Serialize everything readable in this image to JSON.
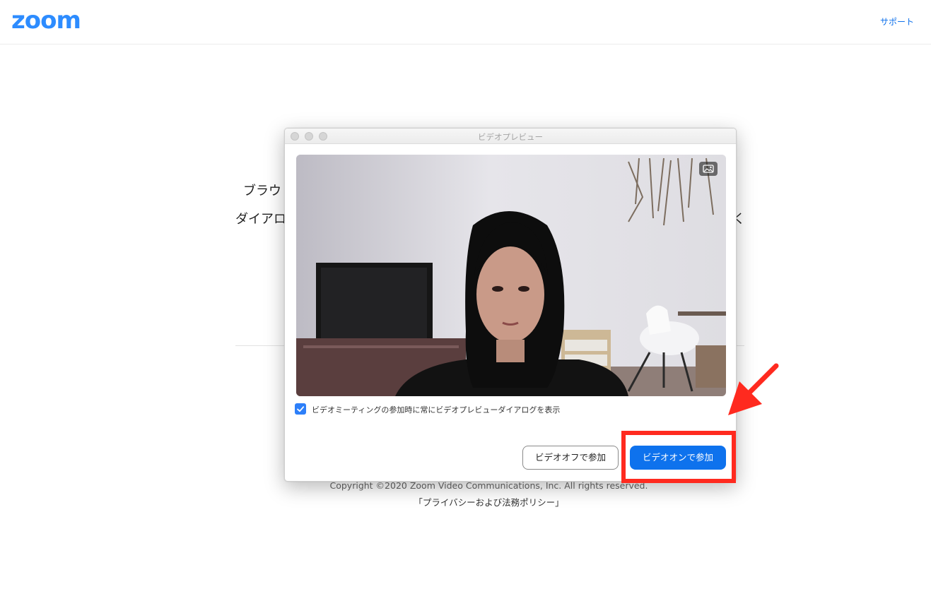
{
  "header": {
    "logo": "zoom",
    "support_link": "サポート"
  },
  "background": {
    "line1": "ブラウ",
    "line2": "ダイアロ",
    "line2_tail": "く",
    "copyright": "Copyright ©2020 Zoom Video Communications, Inc. All rights reserved.",
    "privacy": "「プライバシーおよび法務ポリシー」"
  },
  "dialog": {
    "title": "ビデオプレビュー",
    "checkbox_label": "ビデオミーティングの参加時に常にビデオプレビューダイアログを表示",
    "checkbox_checked": true,
    "join_without_video": "ビデオオフで参加",
    "join_with_video": "ビデオオンで参加"
  },
  "annotation": {
    "color": "#ff2a1f"
  },
  "colors": {
    "brand": "#2d8cff",
    "primary_button": "#0e72ed",
    "checkbox": "#2d7ff9"
  }
}
